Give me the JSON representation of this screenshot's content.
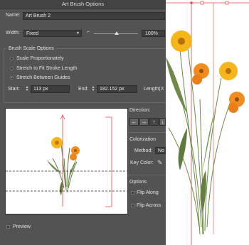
{
  "window": {
    "title": "Art Brush Options"
  },
  "name": {
    "label": "Name:",
    "value": "Art Brush 2"
  },
  "width": {
    "label": "Width:",
    "select_value": "Fixed",
    "percent_value": "100%"
  },
  "brush_scale": {
    "legend": "Brush Scale Options",
    "options": [
      {
        "label": "Scale Proportionately",
        "selected": false
      },
      {
        "label": "Stretch to Fit Stroke Length",
        "selected": false
      },
      {
        "label": "Stretch Between Guides",
        "selected": true
      }
    ],
    "start_label": "Start:",
    "start_value": "113 px",
    "end_label": "End:",
    "end_value": "182.152 px",
    "length_label": "Length(X"
  },
  "direction": {
    "label": "Direction:",
    "buttons": [
      "←",
      "→",
      "↑",
      "↓"
    ]
  },
  "colorization": {
    "header": "Colorization",
    "method_label": "Method:",
    "method_value": "No",
    "key_color_label": "Key Color:"
  },
  "options": {
    "header": "Options",
    "flip_along": "Flip Along",
    "flip_across": "Flip Across"
  },
  "preview": {
    "label": "Preview"
  },
  "colors": {
    "dialog_bg": "#535353",
    "guide_red": "#e8454d",
    "petal": "#f5a414",
    "stem": "#5f7a3d"
  }
}
